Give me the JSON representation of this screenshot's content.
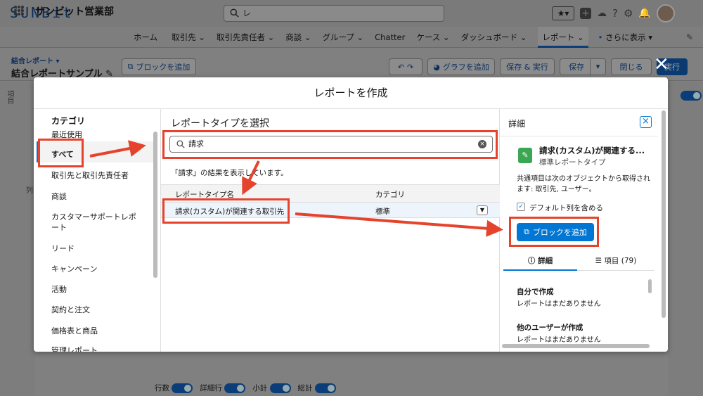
{
  "app": {
    "logo": "SUNBit",
    "name": "サンビット営業部"
  },
  "search": {
    "value": "レ"
  },
  "nav": {
    "items": [
      "ホーム",
      "取引先",
      "取引先責任者",
      "商談",
      "グループ",
      "Chatter",
      "ケース",
      "ダッシュボード",
      "レポート"
    ],
    "more": "さらに表示"
  },
  "header": {
    "type_label": "結合レポート",
    "title": "結合レポートサンプル",
    "add_block": "ブロックを追加",
    "add_graph": "グラフを追加",
    "save_run": "保存 & 実行",
    "save": "保存",
    "close": "閉じる",
    "run": "実行"
  },
  "background": {
    "col_label": "列",
    "item_label": "項目"
  },
  "footer": {
    "rows": "行数",
    "detail_rows": "詳細行",
    "subtotal": "小計",
    "total": "総計"
  },
  "modal": {
    "title": "レポートを作成",
    "category_header": "カテゴリ",
    "categories": [
      "最近使用",
      "すべて",
      "取引先と取引先責任者",
      "商談",
      "カスタマーサポートレポート",
      "リード",
      "キャンペーン",
      "活動",
      "契約と注文",
      "価格表と商品",
      "管理レポート"
    ],
    "selected_category": "すべて",
    "mid_title": "レポートタイプを選択",
    "search_value": "請求",
    "result_note": "「請求」の結果を表示しています。",
    "col_name": "レポートタイプ名",
    "col_category": "カテゴリ",
    "row": {
      "name": "請求(カスタム)が関連する取引先",
      "category": "標準"
    },
    "detail": {
      "title": "詳細",
      "report_name": "請求(カスタム)が関連する...",
      "report_type": "標準レポートタイプ",
      "description": "共通項目は次のオブジェクトから取得されます: 取引先, ユーザー。",
      "default_cols": "デフォルト列を含める",
      "add_block": "ブロックを追加",
      "tab_detail": "詳細",
      "tab_fields": "項目 (79)",
      "created_by_me": "自分で作成",
      "none_yet_1": "レポートはまだありません",
      "created_by_others": "他のユーザーが作成",
      "none_yet_2": "レポートはまだありません"
    }
  },
  "colors": {
    "primary": "#0176d3",
    "annotation_red": "#e5432c",
    "dark_navy": "#0b3d78"
  }
}
